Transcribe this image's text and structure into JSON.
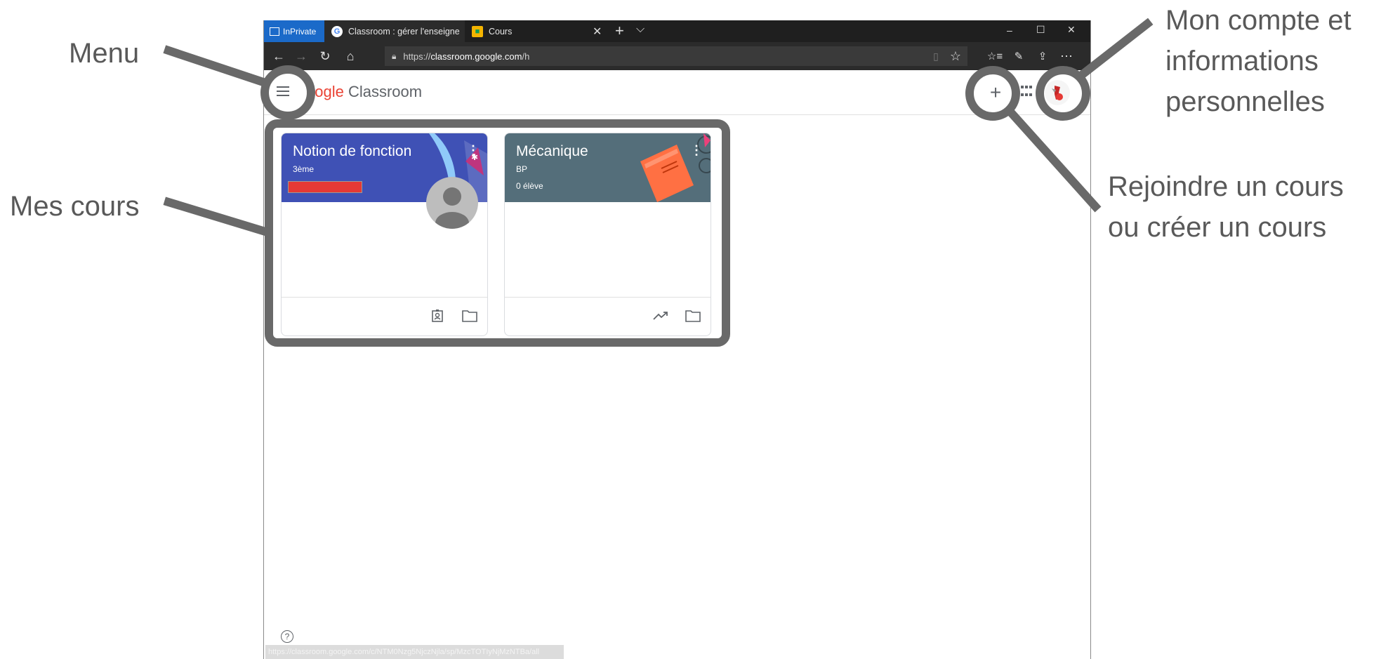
{
  "browser": {
    "inprivate_label": "InPrivate",
    "tabs": [
      {
        "label": "Classroom : gérer l'enseigne"
      },
      {
        "label": "Cours"
      }
    ],
    "new_tab": "+",
    "tab_menu": "⌵",
    "window_controls": {
      "minimize": "–",
      "maximize": "☐",
      "close": "✕"
    },
    "url_prefix": "https://",
    "url_host": "classroom.google.com",
    "url_path": "/h",
    "status_url": "https://classroom.google.com/c/NTM0Nzg5NjczNjla/sp/MzcTOTIyNjMzNTBa/all"
  },
  "app": {
    "logo_g": "oogle",
    "logo_classroom": "Classroom",
    "help": "?"
  },
  "courses": [
    {
      "title": "Notion de fonction",
      "section": "3ème",
      "color": "#3f51b5"
    },
    {
      "title": "Mécanique",
      "section": "BP",
      "students": "0 élève",
      "color": "#546e7a"
    }
  ],
  "annotations": {
    "menu": "Menu",
    "mes_cours": "Mes cours",
    "compte_line1": "Mon compte et",
    "compte_line2": "informations",
    "compte_line3": "personnelles",
    "rejoindre_line1": "Rejoindre un cours",
    "rejoindre_line2": "ou créer un cours"
  },
  "colors": {
    "annotation_gray": "#696969",
    "accent_blue": "#1b6ac9",
    "red_bar": "#e53935"
  }
}
